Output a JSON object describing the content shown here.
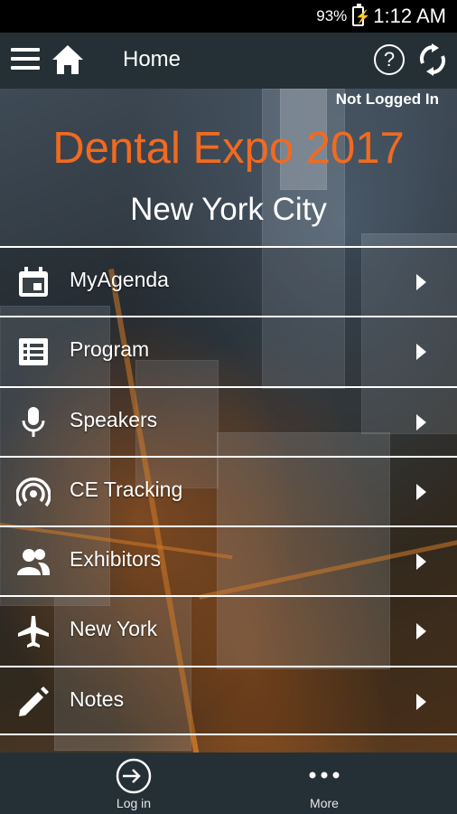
{
  "status_bar": {
    "battery_percent": "93%",
    "time": "1:12 AM"
  },
  "app_bar": {
    "title": "Home",
    "icons": [
      "menu-icon",
      "home-icon",
      "help-icon",
      "sync-icon"
    ]
  },
  "hero": {
    "login_status": "Not Logged In",
    "event_title": "Dental Expo 2017",
    "event_city": "New York City",
    "accent_color": "#f26a1f"
  },
  "menu": {
    "items": [
      {
        "label": "MyAgenda",
        "icon": "calendar-icon"
      },
      {
        "label": "Program",
        "icon": "list-icon"
      },
      {
        "label": "Speakers",
        "icon": "microphone-icon"
      },
      {
        "label": "CE Tracking",
        "icon": "broadcast-icon"
      },
      {
        "label": "Exhibitors",
        "icon": "people-icon"
      },
      {
        "label": "New York",
        "icon": "airplane-icon"
      },
      {
        "label": "Notes",
        "icon": "pencil-icon"
      }
    ]
  },
  "bottom_bar": {
    "login_label": "Log in",
    "more_label": "More"
  }
}
